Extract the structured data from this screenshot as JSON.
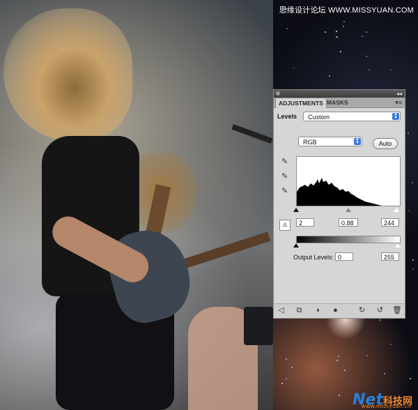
{
  "watermark": {
    "top_text": "思缘设计论坛 WWW.MISSYUAN.COM",
    "bottom_net": "Net",
    "bottom_cn": "科技网",
    "bottom_url": "www.missyuan.cn"
  },
  "panel": {
    "tabs": [
      {
        "label": "ADJUSTMENTS"
      },
      {
        "label": "MASKS"
      }
    ],
    "menu_icon": "panel-menu-icon",
    "levels_label": "Levels",
    "preset_value": "Custom",
    "channel_value": "RGB",
    "auto_label": "Auto",
    "eyedroppers": [
      "black-eyedropper-icon",
      "gray-eyedropper-icon",
      "white-eyedropper-icon"
    ],
    "input_levels": {
      "black": "2",
      "gamma": "0.88",
      "white": "244"
    },
    "output_label": "Output Levels:",
    "output_levels": {
      "black": "0",
      "white": "255"
    },
    "bottom_icons": [
      "back-arrow-icon",
      "clip-layer-icon",
      "visibility-icon",
      "eye-icon",
      "previous-state-icon",
      "reset-icon",
      "trash-icon"
    ]
  }
}
